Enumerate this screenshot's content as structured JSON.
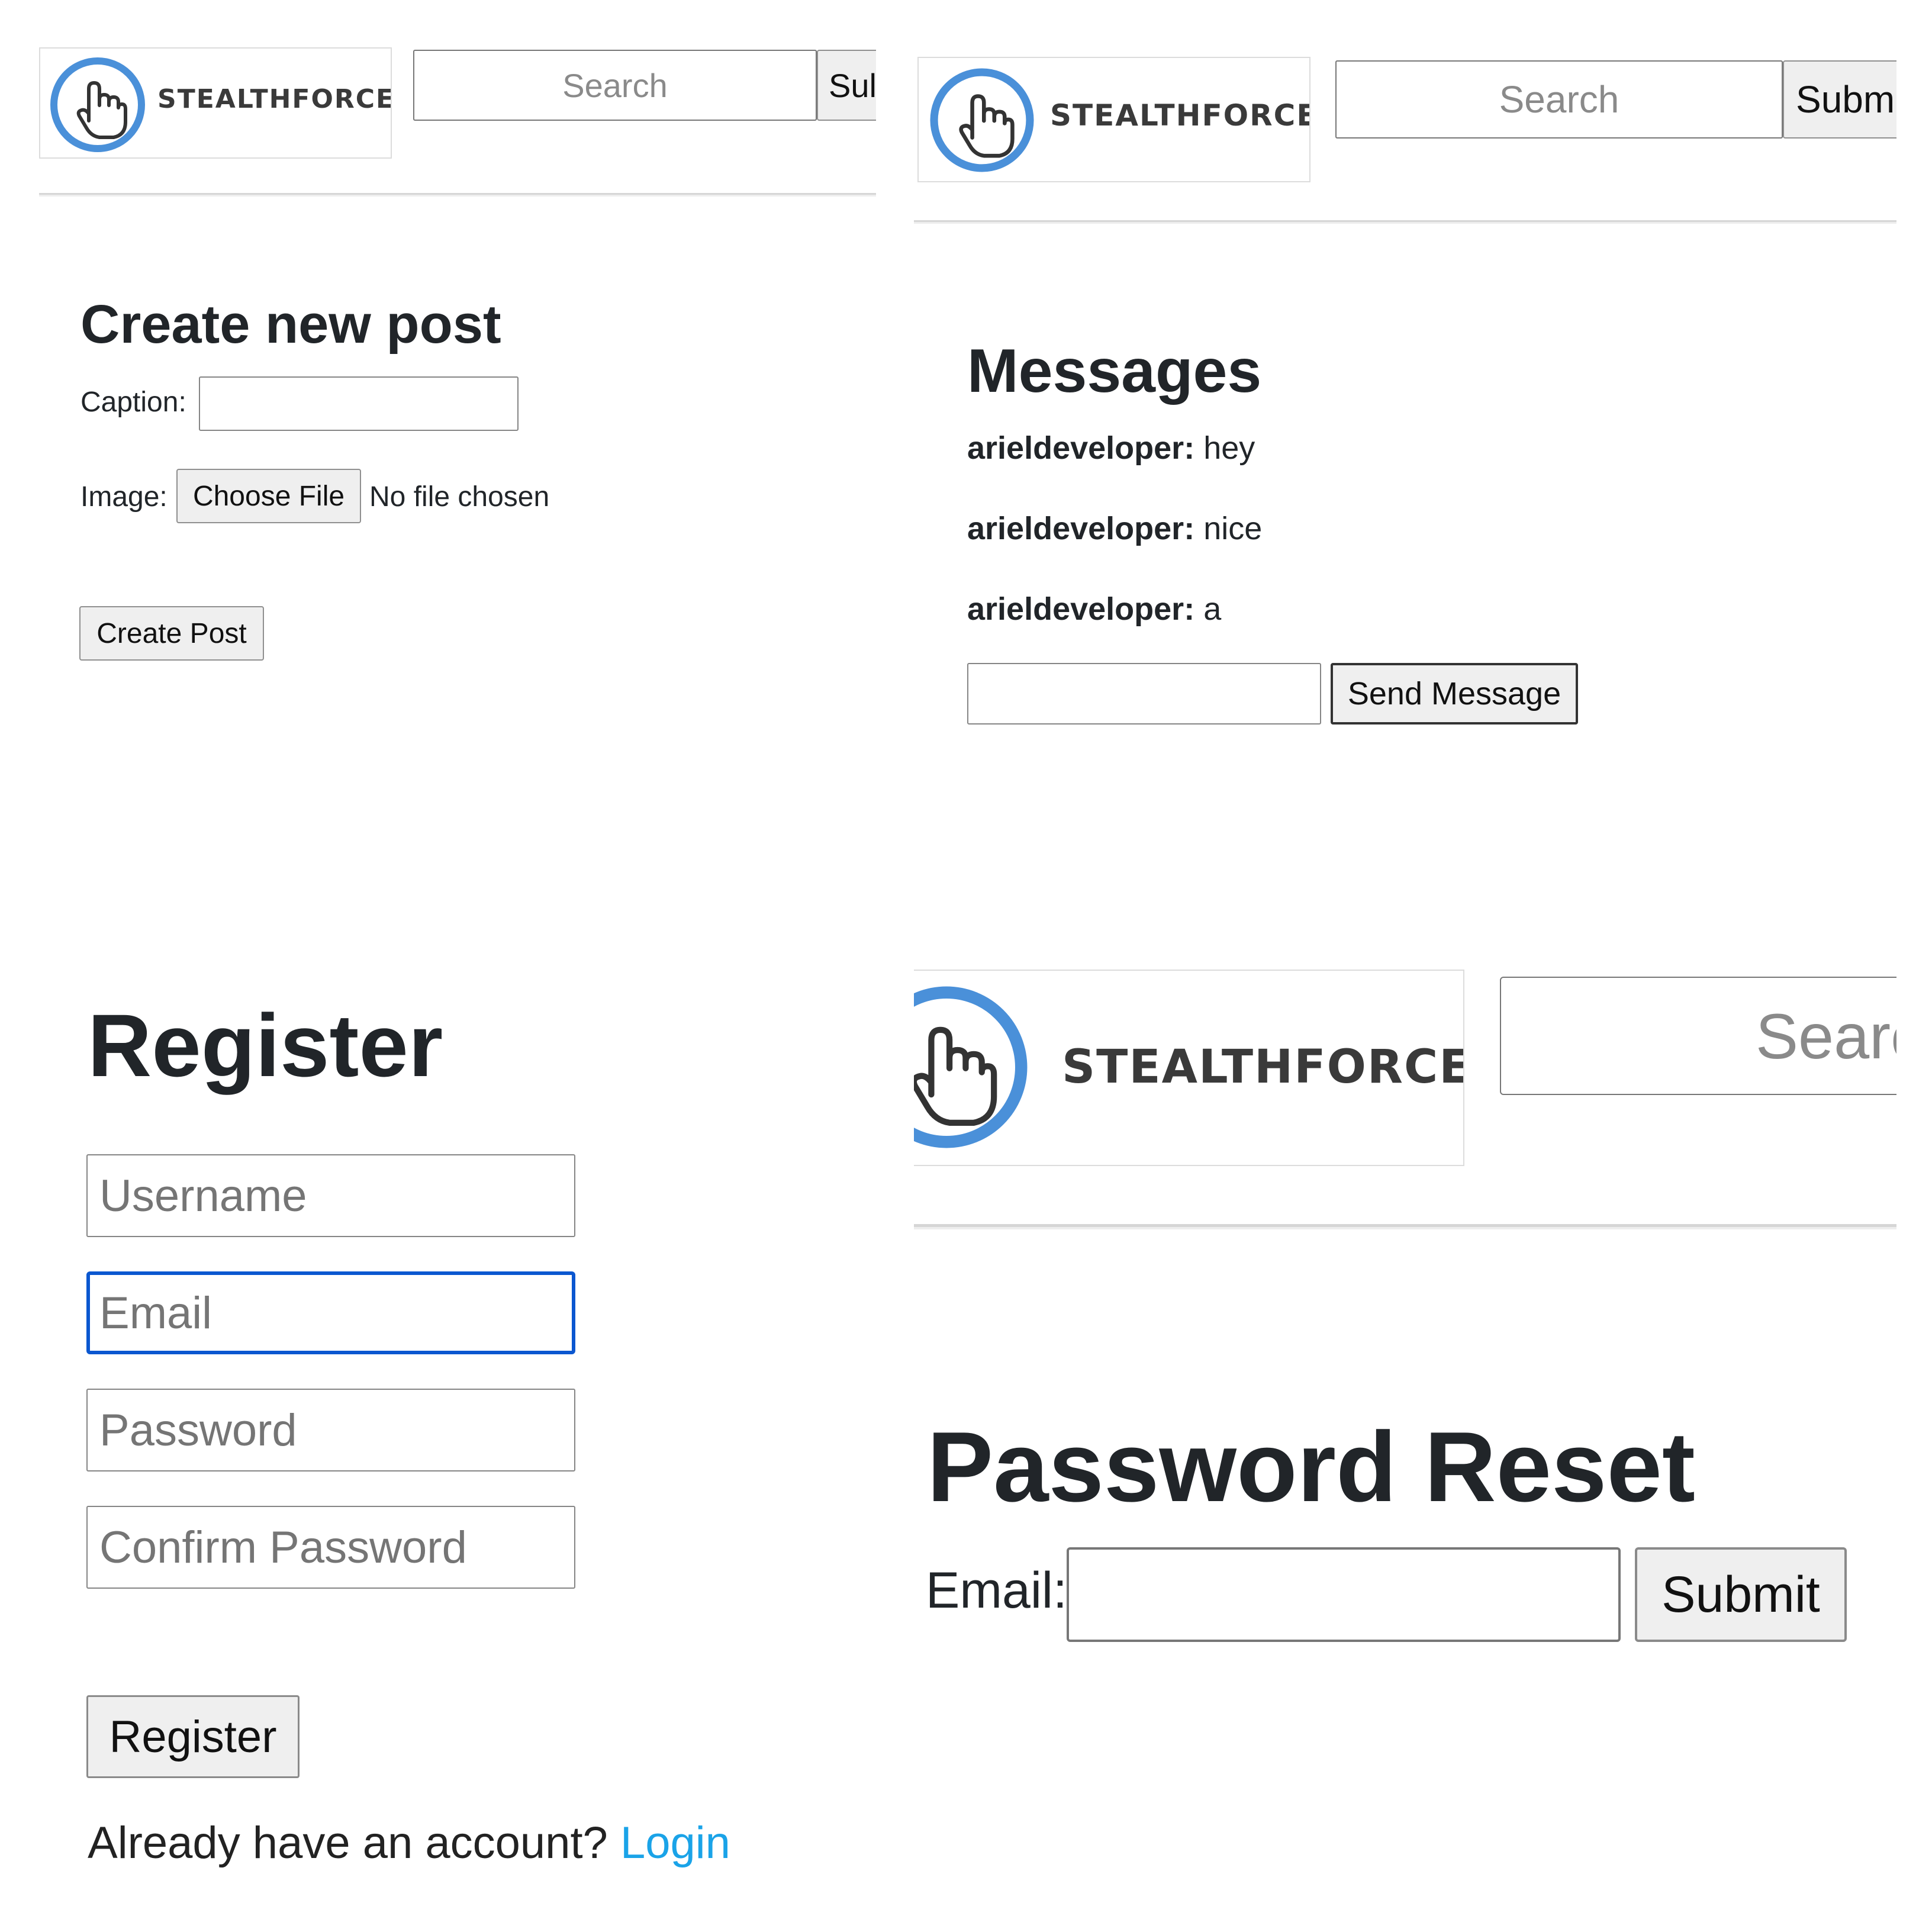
{
  "brand": {
    "name": "STEALTHFORCE"
  },
  "colors": {
    "accent": "#4a90d9",
    "link": "#1aa3e8",
    "focus": "#0b57d0"
  },
  "header": {
    "search_placeholder": "Search",
    "submit_label_cut_1": "Sul",
    "submit_label_cut_2": "Subm",
    "search_placeholder_cut": "Searc"
  },
  "create_post": {
    "title": "Create new post",
    "caption_label": "Caption:",
    "image_label": "Image:",
    "choose_file_label": "Choose File",
    "no_file_label": "No file chosen",
    "submit_label": "Create Post"
  },
  "messages": {
    "title": "Messages",
    "items": [
      {
        "user": "arieldeveloper:",
        "text": "hey"
      },
      {
        "user": "arieldeveloper:",
        "text": "nice"
      },
      {
        "user": "arieldeveloper:",
        "text": "a"
      }
    ],
    "send_label": "Send Message"
  },
  "register": {
    "title": "Register",
    "username_placeholder": "Username",
    "email_placeholder": "Email",
    "password_placeholder": "Password",
    "confirm_placeholder": "Confirm Password",
    "submit_label": "Register",
    "login_prompt": "Already have an account?",
    "login_link": "Login"
  },
  "password_reset": {
    "title": "Password Reset",
    "email_label": "Email:",
    "submit_label": "Submit"
  }
}
